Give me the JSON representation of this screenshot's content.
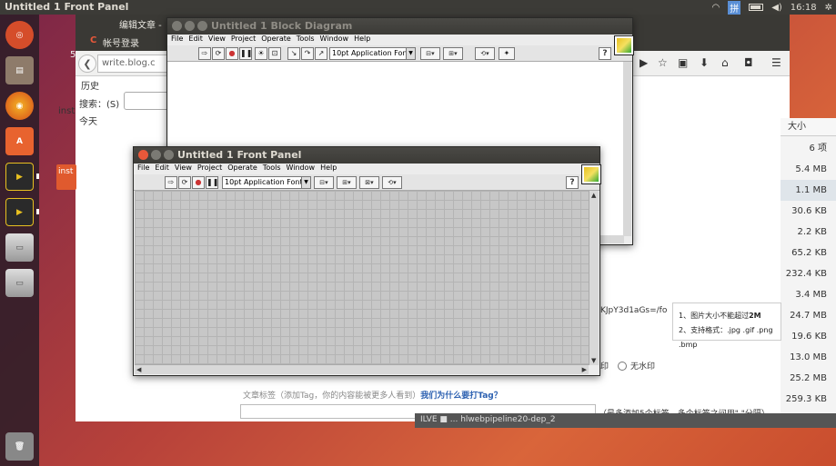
{
  "top_panel": {
    "title": "Untitled 1 Front Panel",
    "input_method": "拼",
    "time": "16:18"
  },
  "launcher": {
    "items": [
      "ubuntu-dash",
      "files",
      "firefox",
      "software-center",
      "labview",
      "labview-2",
      "drive",
      "drive-2",
      "trash"
    ]
  },
  "bg_browser": {
    "tab1": "编辑文章 -",
    "tab2": "帐号登录",
    "url": "write.blog.c",
    "history_title": "历史",
    "search_label": "搜索：(S)",
    "today": "今天",
    "left_stub_1": "5",
    "left_stub_2": "inst",
    "left_badge": "inst"
  },
  "size_column": {
    "header": "大小",
    "rows": [
      "6 项",
      "5.4 MB",
      "1.1 MB",
      "30.6 KB",
      "2.2 KB",
      "65.2 KB",
      "232.4 KB",
      "3.4 MB",
      "24.7 MB",
      "19.6 KB",
      "13.0 MB",
      "25.2 MB",
      "259.3 KB"
    ]
  },
  "upload_notice": {
    "line1_prefix": "1、图片大小不能超过",
    "line1_bold": "2M",
    "line2": "2、支持格式：.jpg .gif .png .bmp"
  },
  "image_code": "KJpY3d1aGs=/fo",
  "watermark_option_a": "印",
  "watermark_option_b": "无水印",
  "tag_label": "文章标签（添加Tag，你的内容能被更多人看到）",
  "tag_link": "我们为什么要打Tag？",
  "tag_hint": "（最多添加5个标签，多个标签之间用\",\"分隔）",
  "bottom_bar_text": "ILVE ■ ... hlwebpipeline20-dep_2",
  "block_diagram": {
    "title": "Untitled 1 Block Diagram",
    "menus": [
      "File",
      "Edit",
      "View",
      "Project",
      "Operate",
      "Tools",
      "Window",
      "Help"
    ],
    "font": "10pt Application Font"
  },
  "front_panel": {
    "title": "Untitled 1 Front Panel",
    "menus": [
      "File",
      "Edit",
      "View",
      "Project",
      "Operate",
      "Tools",
      "Window",
      "Help"
    ],
    "font": "10pt Application Font"
  },
  "colors": {
    "accent": "#e9583a",
    "panel": "#3c3b37",
    "grid": "#c7c7c7"
  }
}
